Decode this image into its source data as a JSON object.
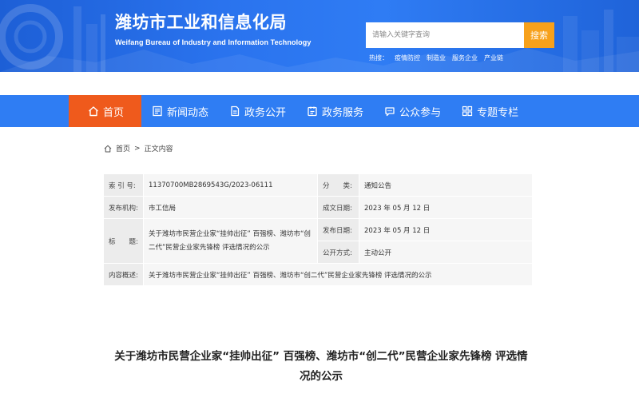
{
  "header": {
    "title": "潍坊市工业和信息化局",
    "subtitle": "Weifang Bureau of Industry and Information Technology",
    "search": {
      "placeholder": "请输入关键字查询",
      "button_label": "搜索"
    },
    "hot": {
      "label": "热搜：",
      "links": [
        "疫情防控",
        "制造业",
        "服务企业",
        "产业链"
      ]
    }
  },
  "nav": {
    "items": [
      {
        "label": "首页",
        "icon": "home-icon",
        "active": true
      },
      {
        "label": "新闻动态",
        "icon": "news-icon",
        "active": false
      },
      {
        "label": "政务公开",
        "icon": "document-icon",
        "active": false
      },
      {
        "label": "政务服务",
        "icon": "service-icon",
        "active": false
      },
      {
        "label": "公众参与",
        "icon": "chat-icon",
        "active": false
      },
      {
        "label": "专题专栏",
        "icon": "grid-icon",
        "active": false
      }
    ]
  },
  "breadcrumb": {
    "home": "首页",
    "separator": ">",
    "current": "正文内容"
  },
  "info": {
    "index_label": "索 引 号:",
    "index_value": "11370700MB2869543G/2023-06111",
    "category_label": "分　　类:",
    "category_value": "通知公告",
    "publisher_label": "发布机构:",
    "publisher_value": "市工信局",
    "created_label": "成文日期:",
    "created_value": "2023 年 05 月 12 日",
    "title_label": "标　　题:",
    "title_value": "关于潍坊市民营企业家“挂帅出征” 百强榜、潍坊市“创二代”民营企业家先锋榜 评选情况的公示",
    "published_label": "发布日期:",
    "published_value": "2023 年 05 月 12 日",
    "open_label": "公开方式:",
    "open_value": "主动公开",
    "summary_label": "内容概述:",
    "summary_value": "关于潍坊市民营企业家“挂帅出征” 百强榜、潍坊市“创二代”民营企业家先锋榜 评选情况的公示"
  },
  "article": {
    "title": "关于潍坊市民营企业家“挂帅出征” 百强榜、潍坊市“创二代”民营企业家先锋榜 评选情况的公示"
  },
  "colors": {
    "banner": "#2a73ee",
    "nav": "#2f7df3",
    "active_nav": "#ef5a1c",
    "search_button": "#f7a11b"
  }
}
